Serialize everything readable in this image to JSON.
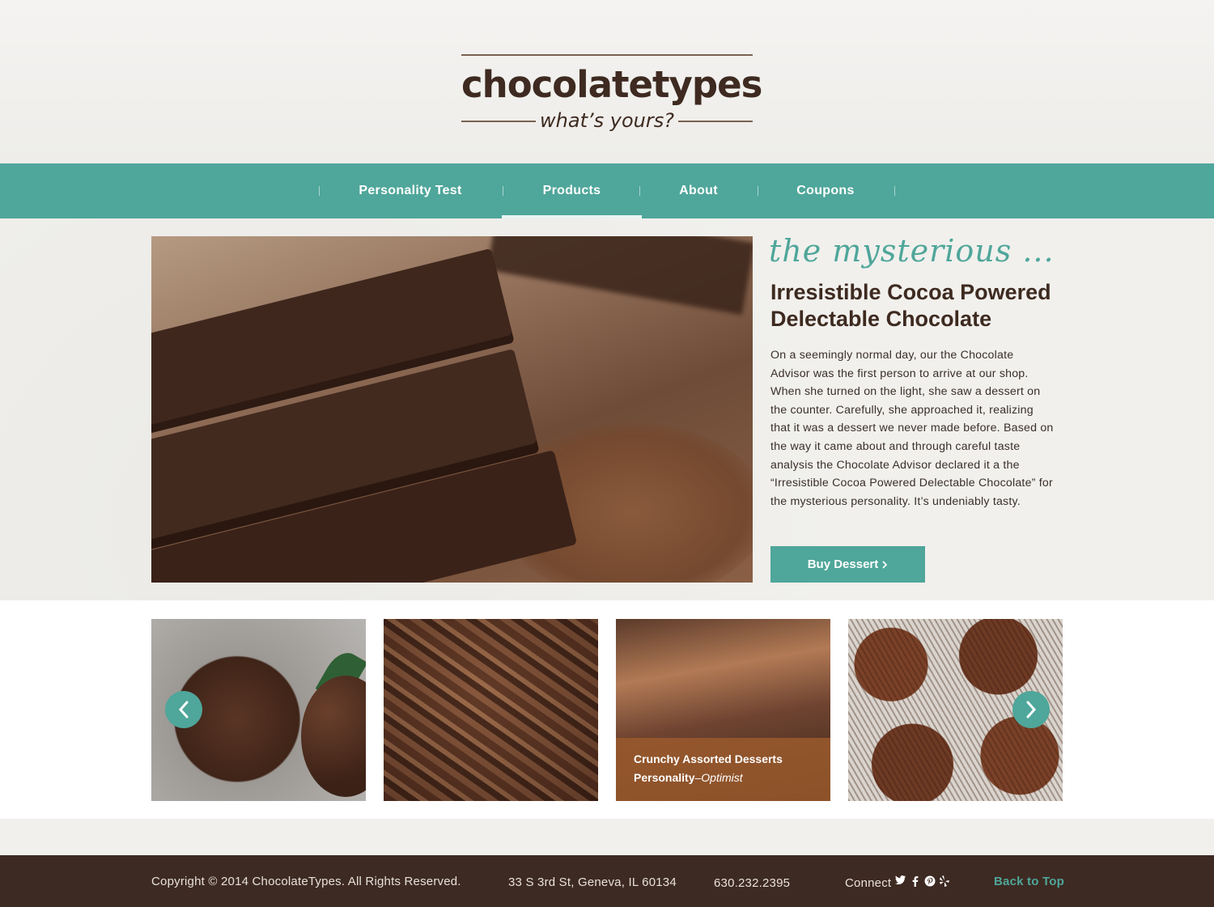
{
  "brand": {
    "title": "chocolatetypes",
    "tagline": "what’s yours?"
  },
  "nav": {
    "items": [
      {
        "label": "Personality Test"
      },
      {
        "label": "Products",
        "active": true
      },
      {
        "label": "About"
      },
      {
        "label": "Coupons"
      }
    ]
  },
  "hero": {
    "script_heading": "the mysterious ...",
    "title": "Irresistible Cocoa Powered Delectable Chocolate",
    "body": "On a seemingly normal day, our the Chocolate Advisor was the first person to arrive at our shop. When she turned on the light, she saw a dessert on the counter. Carefully, she approached it, realizing that it was a dessert we never made before. Based on the way it came about and through careful taste analysis the Chocolate Advisor declared it a the “Irresistible Cocoa Powered Delectable Chocolate” for the mysterious personality. It’s undeniably tasty.",
    "button_label": "Buy Dessert",
    "button_icon": "chevron-right-icon"
  },
  "carousel": {
    "caption_title": "Crunchy Assorted Desserts",
    "caption_label": "Personality",
    "caption_dash": "–",
    "caption_value": "Optimist"
  },
  "footer": {
    "copyright": "Copyright © 2014 ChocolateTypes. All Rights Reserved.",
    "address": "33 S 3rd St, Geneva, IL 60134",
    "phone": "630.232.2395",
    "connect_label": "Connect",
    "social_icons": [
      "twitter-icon",
      "facebook-icon",
      "pinterest-icon",
      "yelp-icon"
    ],
    "back_to_top": "Back to Top"
  },
  "colors": {
    "accent": "#4fa69a",
    "brand_dark": "#3e2a20",
    "footer_bg": "#3d2a22"
  }
}
